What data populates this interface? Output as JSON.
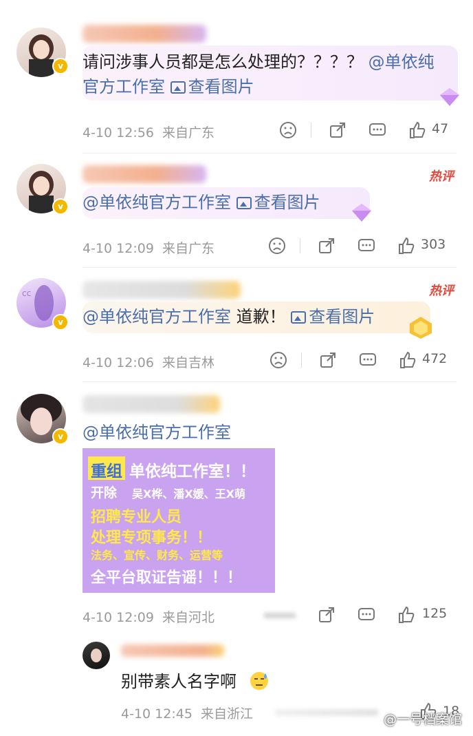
{
  "comments": [
    {
      "text_pre": "请问涉事人员都是怎么处理的？？？？",
      "mention": "@单依纯官方工作室",
      "view_image": "查看图片",
      "date": "4-10 12:56",
      "location": "来自广东",
      "likes": "47",
      "hot": ""
    },
    {
      "text_pre": "",
      "mention": "@单依纯官方工作室",
      "view_image": "查看图片",
      "date": "4-10 12:09",
      "location": "来自广东",
      "likes": "303",
      "hot": "热评"
    },
    {
      "text_pre": "",
      "mention": "@单依纯官方工作室",
      "text_post": "道歉！",
      "view_image": "查看图片",
      "date": "4-10 12:06",
      "location": "来自吉林",
      "likes": "472",
      "hot": "热评"
    },
    {
      "mention": "@单依纯官方工作室",
      "date": "4-10 12:09",
      "location": "来自河北",
      "likes": "125",
      "promo": {
        "line1_tag": "重组",
        "line1_rest": "单依纯工作室！！",
        "line2_tag": "开除",
        "line2_rest": "吴X桦、潘X媛、王X萌",
        "line3": "招聘专业人员",
        "line4": "处理专项事务！！",
        "line5": "法务、宣传、财务、运营等",
        "line6": "全平台取证告谣！！！"
      }
    }
  ],
  "reply": {
    "text": "别带素人名字啊",
    "date": "4-10 12:45",
    "location": "来自浙江",
    "likes": "18"
  },
  "watermark": "@一号档案馆",
  "colors": {
    "link": "#4a6ea9",
    "hot": "#e8473b",
    "verified": "#f5b800",
    "promo_bg": "#c9a2f0",
    "promo_yellow": "#ffe94a"
  }
}
